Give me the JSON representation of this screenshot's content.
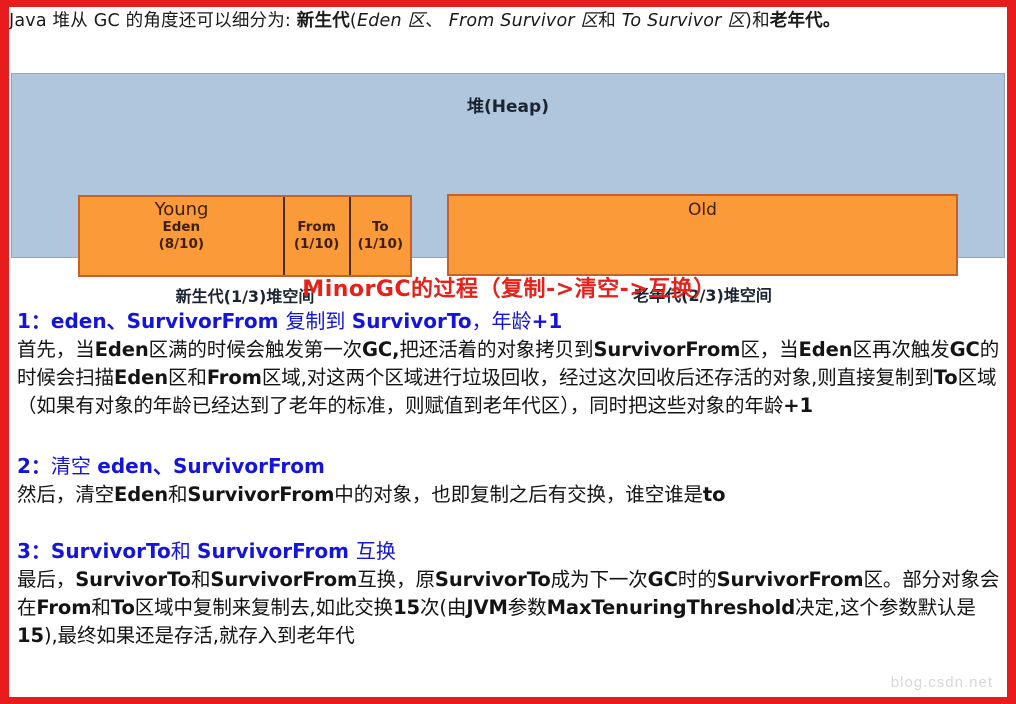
{
  "intro": {
    "part1": "Java 堆从 GC 的角度还可以细分为: ",
    "bold1": "新生代",
    "paren_open": "(",
    "italic1": "Eden 区",
    "sep1": "、 ",
    "italic2": "From Survivor 区",
    "sep2": "和 ",
    "italic3": "To Survivor 区",
    "paren_close": ")",
    "sep3": "和",
    "bold2": "老年代。"
  },
  "diagram": {
    "heap_title": "堆(Heap)",
    "young": {
      "label": "Young",
      "caption": "新生代(1/3)堆空间",
      "cells": [
        {
          "name": "Eden",
          "ratio": "(8/10)"
        },
        {
          "name": "From",
          "ratio": "(1/10)"
        },
        {
          "name": "To",
          "ratio": "(1/10)"
        }
      ]
    },
    "old": {
      "label": "Old",
      "caption": "老年代(2/3)堆空间"
    },
    "colors": {
      "heap_background": "#afc6dc",
      "region_fill": "#fa9a38",
      "region_border": "#c4622a",
      "divider": "#4a2a10",
      "page_border": "#e81c1c"
    }
  },
  "section_title": "MinorGC的过程（复制->清空->互换）",
  "steps": [
    {
      "heading_num": "1：",
      "heading_a": "eden、SurvivorFrom ",
      "heading_b": "复制到 ",
      "heading_c": "SurvivorTo",
      "heading_d": "，年龄",
      "heading_e": "+1",
      "body": [
        {
          "t": "首先，当",
          "b": false
        },
        {
          "t": "Eden",
          "b": true
        },
        {
          "t": "区满的时候会触发第一次",
          "b": false
        },
        {
          "t": "GC,",
          "b": true
        },
        {
          "t": "把还活着的对象拷贝到",
          "b": false
        },
        {
          "t": "SurvivorFrom",
          "b": true
        },
        {
          "t": "区，当",
          "b": false
        },
        {
          "t": "Eden",
          "b": true
        },
        {
          "t": "区再次触发",
          "b": false
        },
        {
          "t": "GC",
          "b": true
        },
        {
          "t": "的时候会扫描",
          "b": false
        },
        {
          "t": "Eden",
          "b": true
        },
        {
          "t": "区和",
          "b": false
        },
        {
          "t": "From",
          "b": true
        },
        {
          "t": "区域,对这两个区域进行垃圾回收，经过这次回收后还存活的对象,则直接复制到",
          "b": false
        },
        {
          "t": "To",
          "b": true
        },
        {
          "t": "区域（如果有对象的年龄已经达到了老年的标准，则赋值到老年代区），同时把这些对象的年龄",
          "b": false
        },
        {
          "t": "+1",
          "b": true
        }
      ]
    },
    {
      "heading_num": "2：",
      "heading_a": "清空 ",
      "heading_b": "eden、SurvivorFrom",
      "heading_c": "",
      "heading_d": "",
      "heading_e": "",
      "body": [
        {
          "t": "然后，清空",
          "b": false
        },
        {
          "t": "Eden",
          "b": true
        },
        {
          "t": "和",
          "b": false
        },
        {
          "t": "SurvivorFrom",
          "b": true
        },
        {
          "t": "中的对象，也即复制之后有交换，谁空谁是",
          "b": false
        },
        {
          "t": "to",
          "b": true
        }
      ]
    },
    {
      "heading_num": "3：",
      "heading_a": "SurvivorTo",
      "heading_b": "和 ",
      "heading_c": "SurvivorFrom ",
      "heading_d": "互换",
      "heading_e": "",
      "body": [
        {
          "t": "最后，",
          "b": false
        },
        {
          "t": "SurvivorTo",
          "b": true
        },
        {
          "t": "和",
          "b": false
        },
        {
          "t": "SurvivorFrom",
          "b": true
        },
        {
          "t": "互换，原",
          "b": false
        },
        {
          "t": "SurvivorTo",
          "b": true
        },
        {
          "t": "成为下一次",
          "b": false
        },
        {
          "t": "GC",
          "b": true
        },
        {
          "t": "时的",
          "b": false
        },
        {
          "t": "SurvivorFrom",
          "b": true
        },
        {
          "t": "区。部分对象会在",
          "b": false
        },
        {
          "t": "From",
          "b": true
        },
        {
          "t": "和",
          "b": false
        },
        {
          "t": "To",
          "b": true
        },
        {
          "t": "区域中复制来复制去,如此交换",
          "b": false
        },
        {
          "t": "15",
          "b": true
        },
        {
          "t": "次(由",
          "b": false
        },
        {
          "t": "JVM",
          "b": true
        },
        {
          "t": "参数",
          "b": false
        },
        {
          "t": "MaxTenuringThreshold",
          "b": true
        },
        {
          "t": "决定,这个参数默认是",
          "b": false
        },
        {
          "t": "15",
          "b": true
        },
        {
          "t": "),最终如果还是存活,就存入到老年代",
          "b": false
        }
      ]
    }
  ],
  "watermark": "blog.csdn.net"
}
